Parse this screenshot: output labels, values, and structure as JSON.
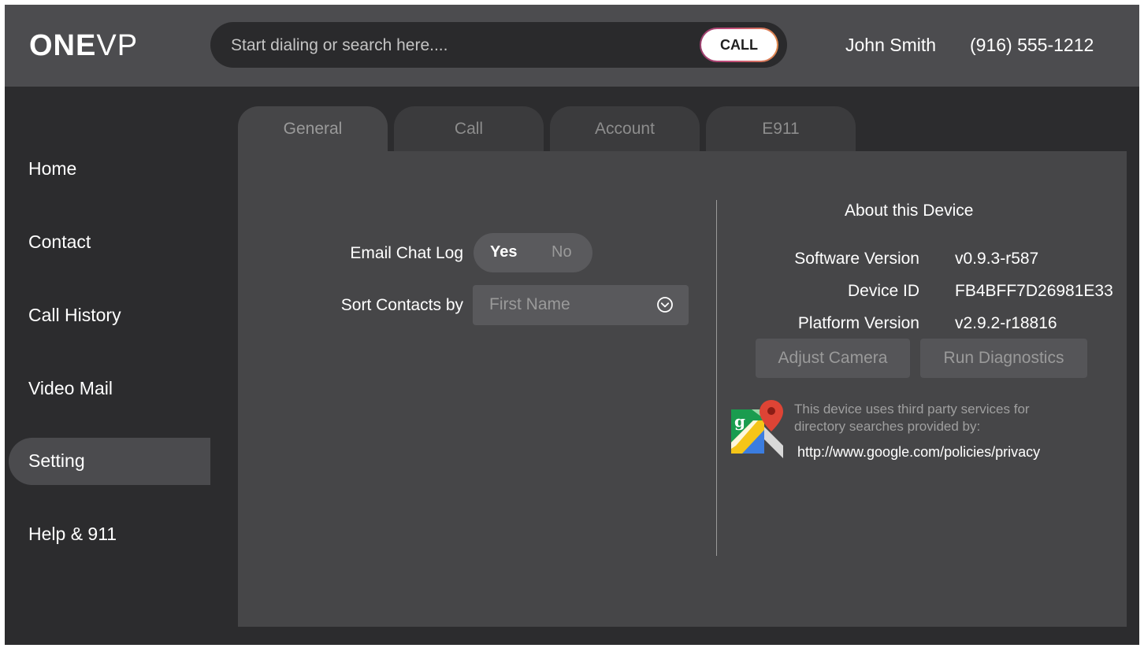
{
  "header": {
    "logo_bold": "ONE",
    "logo_thin": "VP",
    "search_placeholder": "Start dialing or search here....",
    "call_label": "CALL",
    "user_name": "John Smith",
    "user_phone": "(916) 555-1212"
  },
  "sidebar": {
    "items": [
      {
        "label": "Home"
      },
      {
        "label": "Contact"
      },
      {
        "label": "Call History"
      },
      {
        "label": "Video Mail"
      },
      {
        "label": "Setting"
      },
      {
        "label": "Help & 911"
      }
    ],
    "active": "Setting"
  },
  "tabs": [
    {
      "label": "General"
    },
    {
      "label": "Call"
    },
    {
      "label": "Account"
    },
    {
      "label": "E911"
    }
  ],
  "active_tab": "General",
  "general": {
    "email_chat_log": {
      "label": "Email Chat Log",
      "yes": "Yes",
      "no": "No",
      "selected": "Yes"
    },
    "sort_contacts": {
      "label": "Sort Contacts by",
      "value": "First Name"
    }
  },
  "about": {
    "title": "About this Device",
    "rows": [
      {
        "label": "Software Version",
        "value": "v0.9.3-r587"
      },
      {
        "label": "Device ID",
        "value": "FB4BFF7D26981E33"
      },
      {
        "label": "Platform Version",
        "value": "v2.9.2-r18816"
      }
    ],
    "adjust_camera_label": "Adjust Camera",
    "run_diagnostics_label": "Run Diagnostics",
    "notice_line1": "This device uses third party services for",
    "notice_line2": "directory searches provided by:",
    "privacy_link": "http://www.google.com/policies/privacy",
    "maps_icon": "google-maps-icon"
  },
  "colors": {
    "header_bg": "#4c4c4f",
    "app_bg": "#2c2c2e",
    "panel_bg": "#464648",
    "call_gradient_start": "#9b3f6e",
    "call_gradient_end": "#e08a4e"
  }
}
